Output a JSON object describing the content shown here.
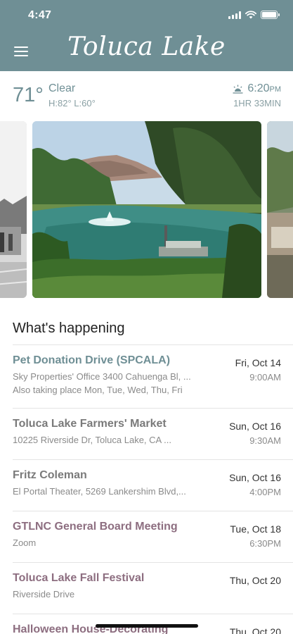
{
  "status_bar": {
    "time": "4:47"
  },
  "header": {
    "title": "Toluca Lake",
    "menu_icon": "hamburger-menu-icon"
  },
  "weather": {
    "temperature": "71°",
    "condition": "Clear",
    "hilo": "H:82° L:60°",
    "sunset_time": "6:20",
    "sunset_ampm": "PM",
    "daylight_remaining": "1HR 33MIN",
    "sunset_icon": "sunset-icon"
  },
  "section": {
    "title": "What's happening"
  },
  "events": [
    {
      "title": "Pet Donation Drive (SPCALA)",
      "location": "Sky Properties' Office 3400 Cahuenga Bl, ...",
      "extra": "Also taking place Mon, Tue, Wed, Thu, Fri",
      "date": "Fri, Oct 14",
      "time": "9:00AM"
    },
    {
      "title": "Toluca Lake Farmers' Market",
      "location": "10225 Riverside Dr, Toluca Lake, CA ...",
      "date": "Sun, Oct 16",
      "time": "9:30AM"
    },
    {
      "title": "Fritz Coleman",
      "location": "El Portal Theater, 5269 Lankershim Blvd,...",
      "date": "Sun, Oct 16",
      "time": "4:00PM"
    },
    {
      "title": "GTLNC General Board Meeting",
      "location": "Zoom",
      "date": "Tue, Oct 18",
      "time": "6:30PM"
    },
    {
      "title": "Toluca Lake Fall Festival",
      "location": "Riverside Drive",
      "date": "Thu, Oct 20",
      "time": ""
    },
    {
      "title": "Halloween House-Decorating",
      "location": "",
      "date": "Thu, Oct 20",
      "time": ""
    }
  ],
  "colors": {
    "header": "#6f8f95",
    "title_teal": "#6f8f95",
    "title_plum": "#8d6e80",
    "title_gray": "#7a7a7a"
  }
}
